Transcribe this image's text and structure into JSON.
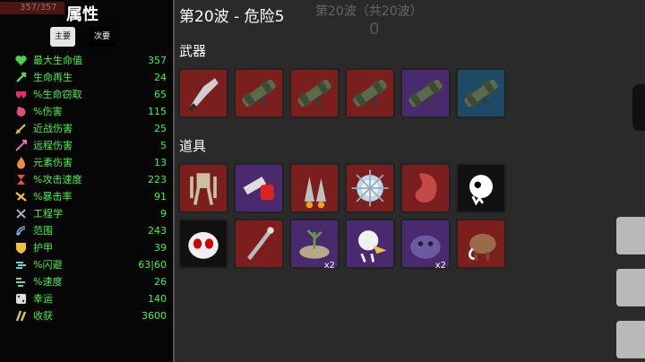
{
  "hp_ghost": "357/357",
  "stats_panel": {
    "title": "属性",
    "tabs": {
      "primary": "主要",
      "secondary": "次要"
    },
    "stats": [
      {
        "label": "最大生命值",
        "value": "357",
        "icon": "heart-icon",
        "color": "#4ad14a"
      },
      {
        "label": "生命再生",
        "value": "24",
        "icon": "regen-icon",
        "color": "#5bd15b"
      },
      {
        "label": "%生命窃取",
        "value": "65",
        "icon": "vampire-icon",
        "color": "#e0306a"
      },
      {
        "label": "%伤害",
        "value": "115",
        "icon": "damage-icon",
        "color": "#e04f74"
      },
      {
        "label": "近战伤害",
        "value": "25",
        "icon": "sword-icon",
        "color": "#e0b74f"
      },
      {
        "label": "远程伤害",
        "value": "5",
        "icon": "arrow-icon",
        "color": "#e06fb5"
      },
      {
        "label": "元素伤害",
        "value": "13",
        "icon": "flame-icon",
        "color": "#f08a4a"
      },
      {
        "label": "%攻击速度",
        "value": "223",
        "icon": "hourglass-icon",
        "color": "#e04f4f"
      },
      {
        "label": "%暴击率",
        "value": "91",
        "icon": "crit-icon",
        "color": "#f0c04a"
      },
      {
        "label": "工程学",
        "value": "9",
        "icon": "wrench-icon",
        "color": "#9fb0c0"
      },
      {
        "label": "范围",
        "value": "243",
        "icon": "range-icon",
        "color": "#7fb0e0"
      },
      {
        "label": "护甲",
        "value": "39",
        "icon": "shield-icon",
        "color": "#f0c040"
      },
      {
        "label": "%闪避",
        "value": "63|60",
        "icon": "dodge-icon",
        "color": "#6fd0e0"
      },
      {
        "label": "%速度",
        "value": "26",
        "icon": "speed-icon",
        "color": "#7fd0a0"
      },
      {
        "label": "幸运",
        "value": "140",
        "icon": "dice-icon",
        "color": "#e0e0e0"
      },
      {
        "label": "收获",
        "value": "3600",
        "icon": "harvest-icon",
        "color": "#e0c060"
      }
    ]
  },
  "header": {
    "wave_title": "第20波 - 危险5",
    "wave_ghost": "第20波（共20波）",
    "wave_ghost_count": "0"
  },
  "weapons": {
    "title": "武器",
    "slots": [
      {
        "icon": "cleaver-icon",
        "tier_color": "#7a1e1e"
      },
      {
        "icon": "rocket-launcher-icon",
        "tier_color": "#7a1e1e"
      },
      {
        "icon": "rocket-launcher-icon",
        "tier_color": "#7a1e1e"
      },
      {
        "icon": "rocket-launcher-icon",
        "tier_color": "#7a1e1e"
      },
      {
        "icon": "rocket-launcher-icon",
        "tier_color": "#4a2a6e"
      },
      {
        "icon": "rocket-launcher-icon",
        "tier_color": "#1f4a66"
      }
    ]
  },
  "items": {
    "title": "道具",
    "row1": [
      {
        "icon": "robot-exoskeleton-icon",
        "tier_color": "#7a1e1e",
        "badge": ""
      },
      {
        "icon": "blood-syringe-icon",
        "tier_color": "#4a2a6e",
        "badge": ""
      },
      {
        "icon": "rockets-icon",
        "tier_color": "#7a1e1e",
        "badge": ""
      },
      {
        "icon": "spiked-orb-icon",
        "tier_color": "#7a1e1e",
        "badge": ""
      },
      {
        "icon": "stomach-icon",
        "tier_color": "#7a1e1e",
        "badge": ""
      },
      {
        "icon": "ghost-icon",
        "tier_color": "#111111",
        "badge": ""
      }
    ],
    "row2": [
      {
        "icon": "skull-mask-icon",
        "tier_color": "#111111",
        "badge": ""
      },
      {
        "icon": "robot-arm-icon",
        "tier_color": "#7a1e1e",
        "badge": ""
      },
      {
        "icon": "mortar-plant-icon",
        "tier_color": "#4a2a6e",
        "badge": "x2"
      },
      {
        "icon": "cracked-creature-icon",
        "tier_color": "#4a2a6e",
        "badge": ""
      },
      {
        "icon": "purple-blob-icon",
        "tier_color": "#4a2a6e",
        "badge": "x2"
      },
      {
        "icon": "mammoth-icon",
        "tier_color": "#7a1e1e",
        "badge": ""
      }
    ]
  }
}
